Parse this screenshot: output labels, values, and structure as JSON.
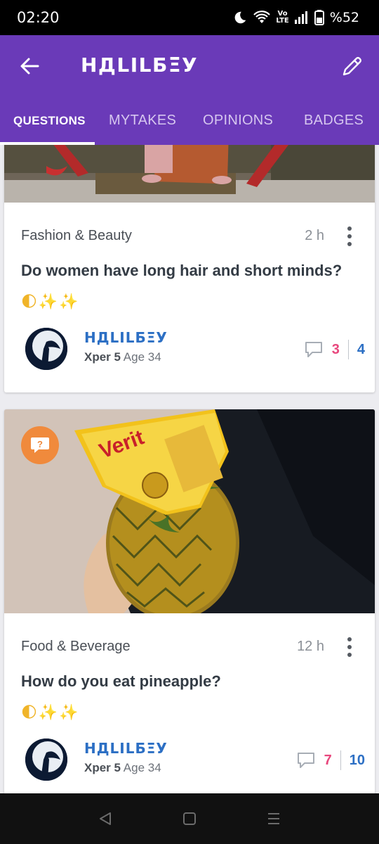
{
  "status_bar": {
    "time": "02:20",
    "battery": "%52",
    "volte_top": "Vo",
    "volte_bottom": "LTE"
  },
  "header": {
    "title": "НДLILБΞУ",
    "back_icon": "arrow-left-icon",
    "edit_icon": "pencil-icon",
    "bg_color": "#6a3ab8"
  },
  "tabs": [
    {
      "label": "QUESTIONS",
      "active": true
    },
    {
      "label": "MYTAKES",
      "active": false
    },
    {
      "label": "OPINIONS",
      "active": false
    },
    {
      "label": "BADGES",
      "active": false
    }
  ],
  "questions": [
    {
      "category": "Fashion & Beauty",
      "time": "2 h",
      "title": "Do women have long hair and short minds?",
      "emoji": "🌓✨✨",
      "author": "НДLILБΞУ",
      "xper": "Xper 5",
      "age": "Age 34",
      "comments": "3",
      "opinions": "4"
    },
    {
      "category": "Food & Beverage",
      "time": "12 h",
      "title": "How do you eat pineapple?",
      "emoji": "🌓✨✨",
      "author": "НДLILБΞУ",
      "xper": "Xper 5",
      "age": "Age 34",
      "comments": "7",
      "opinions": "10"
    }
  ],
  "colors": {
    "comment_count": "#e8477d",
    "opinion_count": "#2c6fc4",
    "author_name": "#2c6fc4",
    "question_badge": "#f08a3c"
  }
}
